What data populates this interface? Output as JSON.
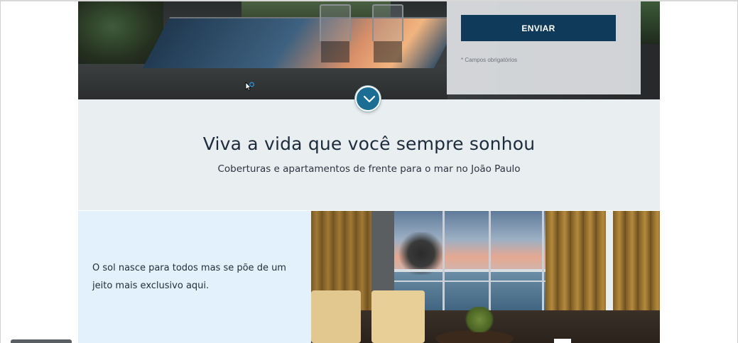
{
  "form": {
    "submit_label": "ENVIAR",
    "required_note": "* Campos obrigatórios"
  },
  "intro": {
    "title": "Viva a vida que você sempre sonhou",
    "subtitle": "Coberturas e apartamentos de frente para o mar no João Paulo"
  },
  "feature": {
    "text": "O sol nasce para todos mas se põe de um jeito mais exclusivo aqui."
  },
  "icons": {
    "scroll_down": "chevron-down-icon",
    "cursor": "mouse-pointer-icon"
  },
  "colors": {
    "button_bg": "#0f3a5a",
    "scroll_button_bg": "#1c6d94",
    "intro_bg": "#e9eef1",
    "feature_bg": "#e2f1fc"
  }
}
